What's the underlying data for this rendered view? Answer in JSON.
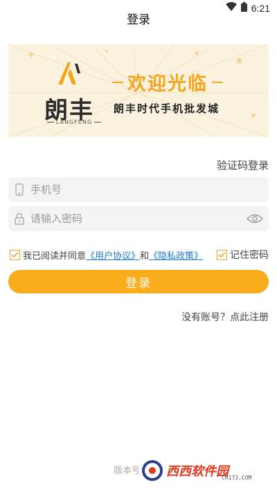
{
  "status": {
    "time": "6:21",
    "icons": [
      "wifi-icon",
      "battery-icon"
    ]
  },
  "header": {
    "title": "登录"
  },
  "banner": {
    "brand": "朗丰",
    "brand_en": "LANGFENG",
    "welcome": "欢迎光临",
    "slogan": "朗丰时代手机批发城",
    "accent_color": "#f4a51c",
    "background_color": "#fbf3e0"
  },
  "form": {
    "mode_link": "验证码登录",
    "phone_placeholder": "手机号",
    "password_placeholder": "请输入密码",
    "agree_prefix": "我已阅读并同意",
    "user_agreement": "《用户协议》",
    "agree_and": "和",
    "privacy_policy": "《隐私政策》",
    "remember_label": "记住密码",
    "login_button": "登录",
    "register_link": "没有账号？点此注册"
  },
  "footer": {
    "version": "版本号",
    "watermark": "西西软件园",
    "watermark_sub": "CR173.COM"
  },
  "colors": {
    "button": "#f9ac1c",
    "link": "#1a7bd6"
  }
}
